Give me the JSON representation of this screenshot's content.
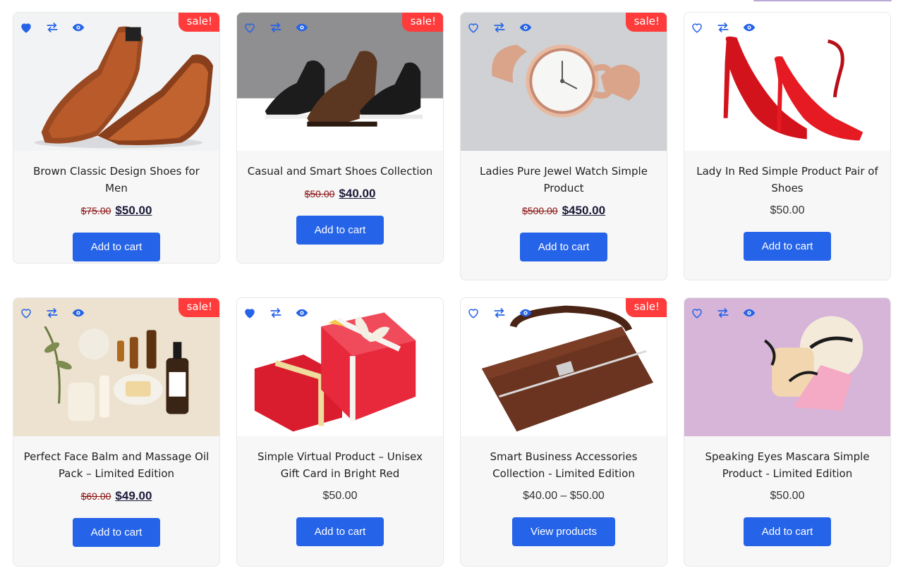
{
  "products": [
    {
      "title": "Brown Classic Design Shoes for Men",
      "sale_label": "sale!",
      "old_price": "$75.00",
      "new_price": "$50.00",
      "price": "",
      "button": "Add to cart",
      "wishlisted": true,
      "image": "brown-loafers"
    },
    {
      "title": "Casual and Smart Shoes Collection",
      "sale_label": "sale!",
      "old_price": "$50.00",
      "new_price": "$40.00",
      "price": "",
      "button": "Add to cart",
      "wishlisted": false,
      "image": "casual-shoes"
    },
    {
      "title": "Ladies Pure Jewel Watch Simple Product",
      "sale_label": "sale!",
      "old_price": "$500.00",
      "new_price": "$450.00",
      "price": "",
      "button": "Add to cart",
      "wishlisted": false,
      "image": "jewel-watch"
    },
    {
      "title": "Lady In Red Simple Product Pair of Shoes",
      "sale_label": "",
      "old_price": "",
      "new_price": "",
      "price": "$50.00",
      "button": "Add to cart",
      "wishlisted": false,
      "image": "red-heels"
    },
    {
      "title": "Perfect Face Balm and Massage Oil Pack – Limited Edition",
      "sale_label": "sale!",
      "old_price": "$69.00",
      "new_price": "$49.00",
      "price": "",
      "button": "Add to cart",
      "wishlisted": false,
      "image": "spa-products"
    },
    {
      "title": "Simple Virtual Product – Unisex Gift Card in Bright Red",
      "sale_label": "",
      "old_price": "",
      "new_price": "",
      "price": "$50.00",
      "button": "Add to cart",
      "wishlisted": true,
      "image": "gift-boxes"
    },
    {
      "title": "Smart Business Accessories Collection - Limited Edition",
      "sale_label": "sale!",
      "old_price": "",
      "new_price": "",
      "price": "$40.00 – $50.00",
      "button": "View products",
      "wishlisted": false,
      "image": "briefcase"
    },
    {
      "title": "Speaking Eyes Mascara Simple Product - Limited Edition",
      "sale_label": "",
      "old_price": "",
      "new_price": "",
      "price": "$50.00",
      "button": "Add to cart",
      "wishlisted": false,
      "image": "eyelashes"
    }
  ],
  "icons": [
    "heart-icon",
    "compare-icon",
    "quick-view-icon"
  ],
  "colors": {
    "accent": "#2563e8",
    "sale_badge": "#ff3b3b",
    "old_price": "#8a1010",
    "card_bg": "#f7f7f7"
  }
}
